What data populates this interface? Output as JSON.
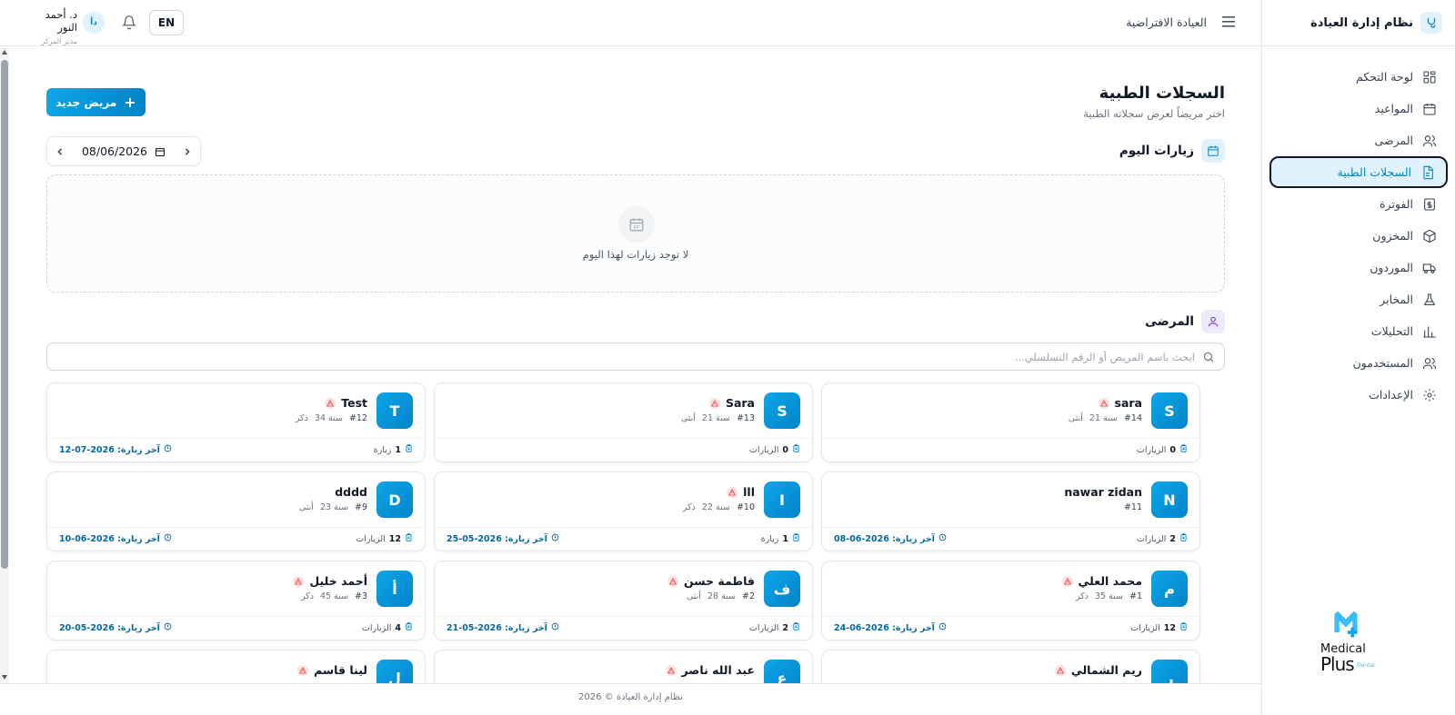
{
  "sidebar": {
    "brand": "نظام إدارة العيادة",
    "items": [
      {
        "label": "لوحة التحكم",
        "icon": "dashboard-icon"
      },
      {
        "label": "المواعيد",
        "icon": "calendar-icon"
      },
      {
        "label": "المرضى",
        "icon": "users-icon"
      },
      {
        "label": "السجلات الطبية",
        "icon": "file-icon",
        "active": true
      },
      {
        "label": "الفوترة",
        "icon": "dollar-icon"
      },
      {
        "label": "المخزون",
        "icon": "box-icon"
      },
      {
        "label": "الموردون",
        "icon": "truck-icon"
      },
      {
        "label": "المخابر",
        "icon": "flask-icon"
      },
      {
        "label": "التحليلات",
        "icon": "chart-icon"
      },
      {
        "label": "المستخدمون",
        "icon": "users-icon"
      },
      {
        "label": "الإعدادات",
        "icon": "gear-icon"
      }
    ],
    "logo": {
      "line1": "Medical",
      "line2": "Plus",
      "line3": "Dental"
    }
  },
  "topbar": {
    "clinic_name": "العيادة الافتراضية",
    "user_name": "د. أحمد النور",
    "user_role": "مدير المركز",
    "avatar_initials": "دأ",
    "lang": "EN"
  },
  "page": {
    "title": "السجلات الطبية",
    "subtitle": "اختر مريضاً لعرض سجلاته الطبية",
    "new_patient": "مريض جديد"
  },
  "visits": {
    "title": "زيارات اليوم",
    "date": "08/06/2026",
    "empty_text": "لا توجد زيارات لهذا اليوم"
  },
  "patients": {
    "title": "المرضى",
    "search_placeholder": "ابحث باسم المريض أو الرقم التسلسلي...",
    "cards": [
      {
        "initial": "S",
        "name": "sara",
        "id": "#14",
        "age": "21 سنة",
        "gender": "أنثى",
        "visits": "0",
        "visits_label": "الزيارات",
        "last_visit": "",
        "warn": true
      },
      {
        "initial": "S",
        "name": "Sara",
        "id": "#13",
        "age": "21 سنة",
        "gender": "أنثى",
        "visits": "0",
        "visits_label": "الزيارات",
        "last_visit": "",
        "warn": true
      },
      {
        "initial": "T",
        "name": "Test",
        "id": "#12",
        "age": "34 سنة",
        "gender": "ذكر",
        "visits": "1",
        "visits_label": "زيارة",
        "last_visit": "آخر زيارة: 2026-07-12",
        "warn": true
      },
      {
        "initial": "N",
        "name": "nawar zidan",
        "id": "#11",
        "age": "",
        "gender": "",
        "visits": "2",
        "visits_label": "الزيارات",
        "last_visit": "آخر زيارة: 2026-06-08",
        "warn": false
      },
      {
        "initial": "I",
        "name": "lll",
        "id": "#10",
        "age": "22 سنة",
        "gender": "ذكر",
        "visits": "1",
        "visits_label": "زيارة",
        "last_visit": "آخر زيارة: 2026-05-25",
        "warn": true
      },
      {
        "initial": "D",
        "name": "dddd",
        "id": "#9",
        "age": "23 سنة",
        "gender": "أنثى",
        "visits": "12",
        "visits_label": "الزيارات",
        "last_visit": "آخر زيارة: 2026-06-10",
        "warn": false
      },
      {
        "initial": "م",
        "name": "محمد العلي",
        "id": "#1",
        "age": "35 سنة",
        "gender": "ذكر",
        "visits": "12",
        "visits_label": "الزيارات",
        "last_visit": "آخر زيارة: 2026-06-24",
        "warn": true
      },
      {
        "initial": "ف",
        "name": "فاطمة حسن",
        "id": "#2",
        "age": "28 سنة",
        "gender": "أنثى",
        "visits": "2",
        "visits_label": "الزيارات",
        "last_visit": "آخر زيارة: 2026-05-21",
        "warn": true
      },
      {
        "initial": "أ",
        "name": "أحمد خليل",
        "id": "#3",
        "age": "45 سنة",
        "gender": "ذكر",
        "visits": "4",
        "visits_label": "الزيارات",
        "last_visit": "آخر زيارة: 2026-05-20",
        "warn": true
      },
      {
        "initial": "ر",
        "name": "ريم الشمالي",
        "id": "",
        "age": "",
        "gender": "",
        "visits": "",
        "visits_label": "",
        "last_visit": "",
        "warn": true
      },
      {
        "initial": "ع",
        "name": "عبد الله ناصر",
        "id": "",
        "age": "",
        "gender": "",
        "visits": "",
        "visits_label": "",
        "last_visit": "",
        "warn": true
      },
      {
        "initial": "ل",
        "name": "لينا قاسم",
        "id": "",
        "age": "",
        "gender": "",
        "visits": "",
        "visits_label": "",
        "last_visit": "",
        "warn": true
      }
    ]
  },
  "footer": {
    "text": "نظام إدارة العيادة © 2026"
  },
  "colors": {
    "accent": "#0ea5e9",
    "accent_dark": "#0284c7",
    "warn": "#ef4444"
  }
}
